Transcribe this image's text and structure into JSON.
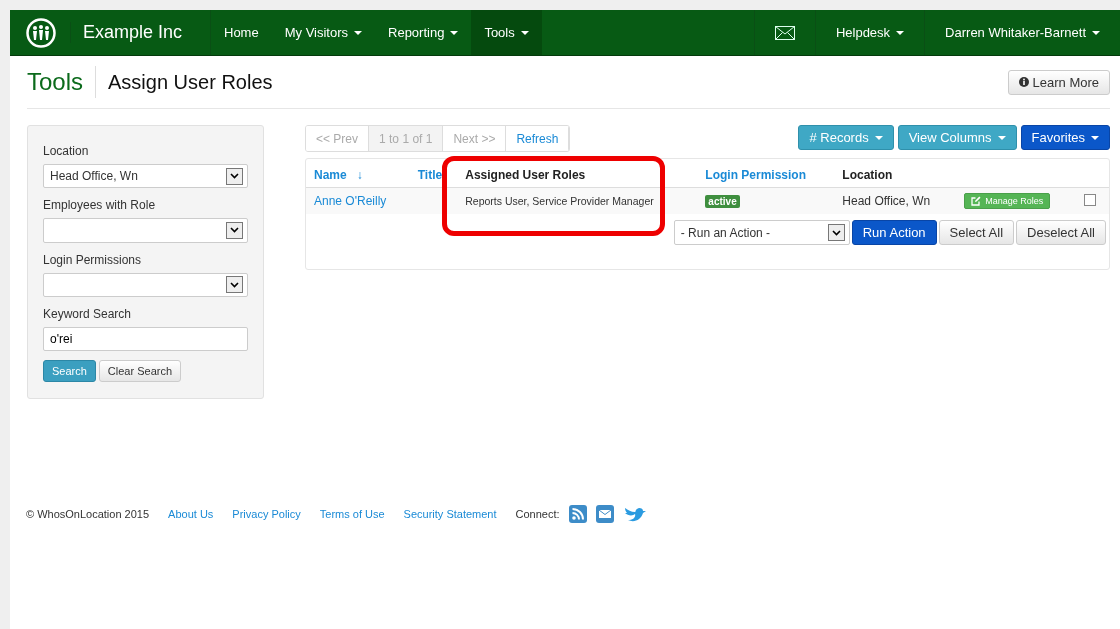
{
  "brand": {
    "name": "Example Inc"
  },
  "nav": [
    {
      "label": "Home",
      "dropdown": false,
      "selected": false
    },
    {
      "label": "My Visitors",
      "dropdown": true,
      "selected": false
    },
    {
      "label": "Reporting",
      "dropdown": true,
      "selected": false
    },
    {
      "label": "Tools",
      "dropdown": true,
      "selected": true
    }
  ],
  "nav_right": [
    {
      "kind": "mail"
    },
    {
      "kind": "menu",
      "label": "Helpdesk"
    },
    {
      "kind": "menu",
      "label": "Darren Whitaker-Barnett"
    }
  ],
  "header": {
    "section": "Tools",
    "title": "Assign User Roles",
    "help_button": "Learn More"
  },
  "filters": [
    {
      "kind": "select",
      "label": "Location",
      "value": "Head Office, Wn"
    },
    {
      "kind": "select",
      "label": "Employees with Role"
    },
    {
      "kind": "select",
      "label": "Login Permissions"
    },
    {
      "kind": "text",
      "label": "Keyword Search",
      "value": "o'rei"
    }
  ],
  "filter_buttons": [
    {
      "label": "Search",
      "kind": "primary"
    },
    {
      "label": "Clear Search",
      "kind": "default"
    }
  ],
  "pager": [
    {
      "label": "<< Prev",
      "disabled": true,
      "selected": false
    },
    {
      "label": "1 to 1 of 1",
      "disabled": true,
      "selected": true
    },
    {
      "label": "Next >>",
      "disabled": true,
      "selected": false
    },
    {
      "label": "Refresh",
      "disabled": false,
      "selected": false
    }
  ],
  "toolbar": [
    {
      "label": "# Records",
      "kind": "info"
    },
    {
      "label": "View Columns",
      "kind": "info"
    },
    {
      "label": "Favorites",
      "kind": "primary"
    }
  ],
  "table": {
    "columns": [
      {
        "label": "Name",
        "sortable": true,
        "sort_icon": "↓"
      },
      {
        "label": "Title",
        "sortable": true
      },
      {
        "label": "Assigned User Roles",
        "sortable": false
      },
      {
        "label": "Login Permission",
        "sortable": true
      },
      {
        "label": "Location",
        "sortable": false
      }
    ],
    "rows": [
      {
        "name": "Anne O'Reilly",
        "roles": "Reports User, Service Provider Manager",
        "permission": "active",
        "location": "Head Office, Wn",
        "action": "Manage Roles",
        "checked": false
      }
    ]
  },
  "bulk": {
    "action_placeholder": "- Run an Action -",
    "buttons": [
      {
        "label": "Run Action",
        "kind": "primary"
      },
      {
        "label": "Select All",
        "kind": "default"
      },
      {
        "label": "Deselect All",
        "kind": "default"
      }
    ]
  },
  "annotation": {
    "kind": "outline",
    "color": "#ee0000"
  },
  "footer": {
    "copyright": "© WhosOnLocation 2015",
    "links": [
      "About Us",
      "Privacy Policy",
      "Terms of Use",
      "Security Statement"
    ],
    "connect_label": "Connect:",
    "social": [
      {
        "kind": "rss"
      },
      {
        "kind": "mail"
      },
      {
        "kind": "bird"
      }
    ]
  }
}
